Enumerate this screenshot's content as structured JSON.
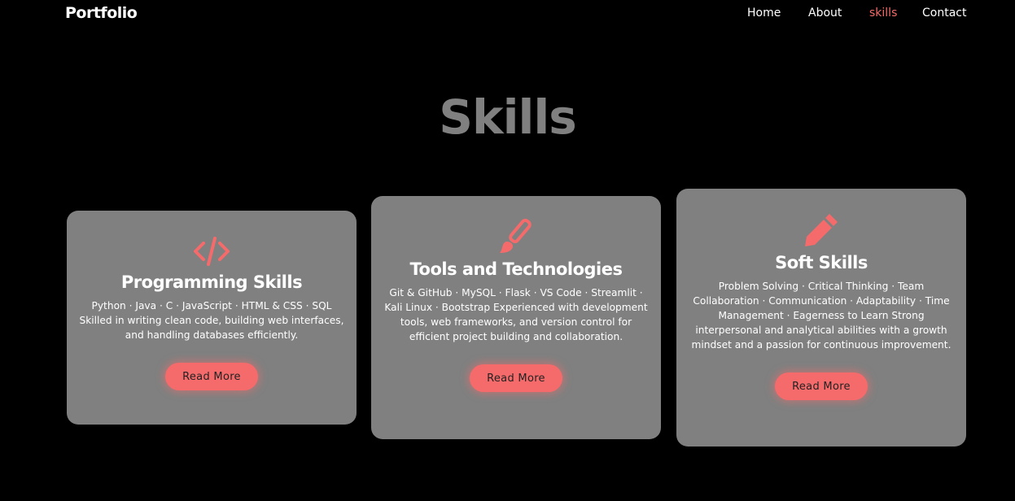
{
  "navbar": {
    "logo": "Portfolio",
    "links": [
      {
        "label": "Home",
        "active": false
      },
      {
        "label": "About",
        "active": false
      },
      {
        "label": "skills",
        "active": true
      },
      {
        "label": "Contact",
        "active": false
      }
    ]
  },
  "section": {
    "title": "Skills"
  },
  "cards": [
    {
      "icon": "code-icon",
      "title": "Programming Skills",
      "text": "Python · Java · C · JavaScript · HTML & CSS · SQL Skilled in writing clean code, building web interfaces, and handling databases efficiently.",
      "button": "Read More"
    },
    {
      "icon": "paintbrush-icon",
      "title": "Tools and Technologies",
      "text": "Git & GitHub · MySQL · Flask · VS Code · Streamlit · Kali Linux · Bootstrap Experienced with development tools, web frameworks, and version control for efficient project building and collaboration.",
      "button": "Read More"
    },
    {
      "icon": "pencil-icon",
      "title": "Soft Skills",
      "text": "Problem Solving · Critical Thinking · Team Collaboration · Communication · Adaptability · Time Management · Eagerness to Learn Strong interpersonal and analytical abilities with a growth mindset and a passion for continuous improvement.",
      "button": "Read More"
    }
  ],
  "colors": {
    "background": "#000000",
    "card": "#808080",
    "accent": "#f56b6b",
    "title": "#808080"
  }
}
